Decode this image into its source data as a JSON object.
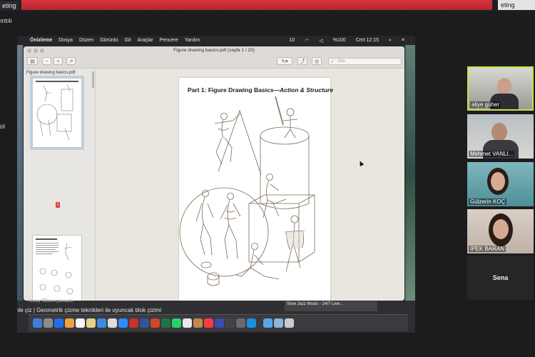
{
  "meeting": {
    "title_fragment": "eting",
    "top_right_fragment": "eting",
    "corner_label": "ıntılı",
    "side_fragment": "ol"
  },
  "mac_menubar": {
    "items": [
      "Önizleme",
      "Dosya",
      "Düzen",
      "Görüntü",
      "Git",
      "Araçlar",
      "Pencere",
      "Yardım"
    ],
    "status": {
      "battery": "10",
      "percent": "%100",
      "datetime": "Cmt 12:15"
    }
  },
  "preview": {
    "window_title": "Figure drawing basics.pdf (sayfa 1 / 23)",
    "search_placeholder": "Ara",
    "sidebar_file": "Figure drawing basics.pdf",
    "thumbnails": [
      {
        "page": "1",
        "label": "Part 1: Figure Drawing Basics—Action & Structure"
      },
      {
        "page": "2",
        "label": "The Bean Figure"
      }
    ],
    "document": {
      "title_main": "Part 1: Figure Drawing Basics—",
      "title_italic": "Action & Structure"
    }
  },
  "bottom": {
    "chat_line": "imle çiz | Geometrik çizme teknikleri ile oyuncak blok çizimi",
    "pinned_line": "Kuzey Kutbu Ayakkabılı",
    "music": "Slow Jazz Music - 24/7 Live..."
  },
  "participants": [
    {
      "name": "aliye güher"
    },
    {
      "name": "Mehmet VANLI..."
    },
    {
      "name": "Gülzerin KOÇ"
    },
    {
      "name": "İPEK BARAN"
    },
    {
      "name": "Sena"
    }
  ],
  "colors": {
    "active_speaker": "#c5e34a",
    "meeting_red": "#d7343f"
  }
}
